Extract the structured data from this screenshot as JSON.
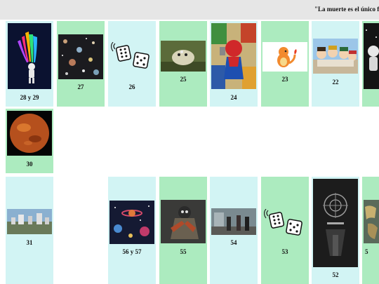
{
  "header": {
    "quote": "\"La muerte es el único fi"
  },
  "colors": {
    "cyan": "#d2f4f4",
    "green": "#acebbf",
    "topbar": "#e6e6e6"
  },
  "row1": [
    {
      "label": "28 y 29",
      "image": "astronaut-rainbow-image"
    },
    {
      "label": "27",
      "image": "space-planets-image"
    },
    {
      "label": "26",
      "image": "dice-icon"
    },
    {
      "label": "25",
      "image": "creature-image"
    },
    {
      "label": "24",
      "image": "comic-heroes-image"
    },
    {
      "label": "23",
      "image": "charmander-image"
    },
    {
      "label": "22",
      "image": "anime-group-image"
    },
    {
      "label": "",
      "image": "astronaut-bw-image"
    }
  ],
  "row2": [
    {
      "label": "30",
      "image": "red-planet-image"
    }
  ],
  "row3": [
    {
      "label": "31",
      "image": "city-landscape-image"
    },
    {
      "label": "56 y 57",
      "image": "galaxy-planets-image"
    },
    {
      "label": "55",
      "image": "coraline-image"
    },
    {
      "label": "54",
      "image": "film-scene-image"
    },
    {
      "label": "53",
      "image": "dice-icon"
    },
    {
      "label": "52",
      "image": "dark-poster-image"
    },
    {
      "label": "5",
      "image": "world-map-image"
    }
  ]
}
